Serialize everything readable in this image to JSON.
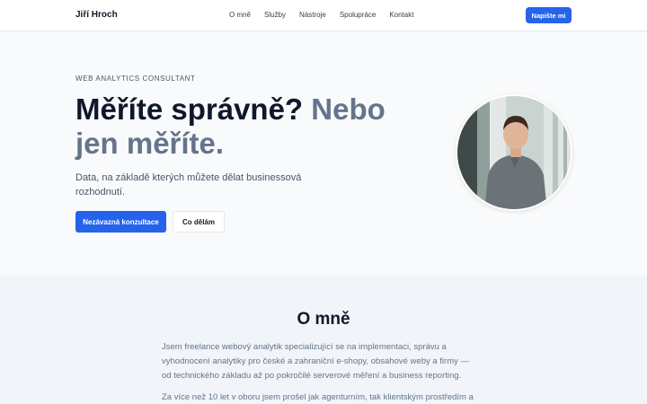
{
  "header": {
    "brand": "Jiří Hroch",
    "nav": [
      {
        "label": "O mně"
      },
      {
        "label": "Služby"
      },
      {
        "label": "Nástroje"
      },
      {
        "label": "Spolupráce"
      },
      {
        "label": "Kontakt"
      }
    ],
    "cta": "Napište mi"
  },
  "hero": {
    "eyebrow": "WEB ANALYTICS CONSULTANT",
    "headline_strong": "Měříte správně?",
    "headline_muted": "Nebo jen měříte.",
    "subtitle": "Data, na základě kterých můžete dělat businessová rozhodnutí.",
    "primary_button": "Nezávazná konzultace",
    "secondary_button": "Co dělám"
  },
  "about": {
    "title": "O mně",
    "paragraph1": "Jsem freelance webový analytik specializující se na implementaci, správu a vyhodnocení analytiky pro české a zahraniční e-shopy, obsahové weby a firmy — od technického základu až po pokročilé serverové měření a business reporting.",
    "paragraph2": "Za více než 10 let v oboru jsem prošel jak agenturním, tak klientským prostředím a"
  },
  "colors": {
    "accent": "#2563eb",
    "heading": "#0f172a",
    "muted_heading": "#64748b",
    "hero_bg": "#f9fafb",
    "about_bg": "#f1f5f9"
  }
}
